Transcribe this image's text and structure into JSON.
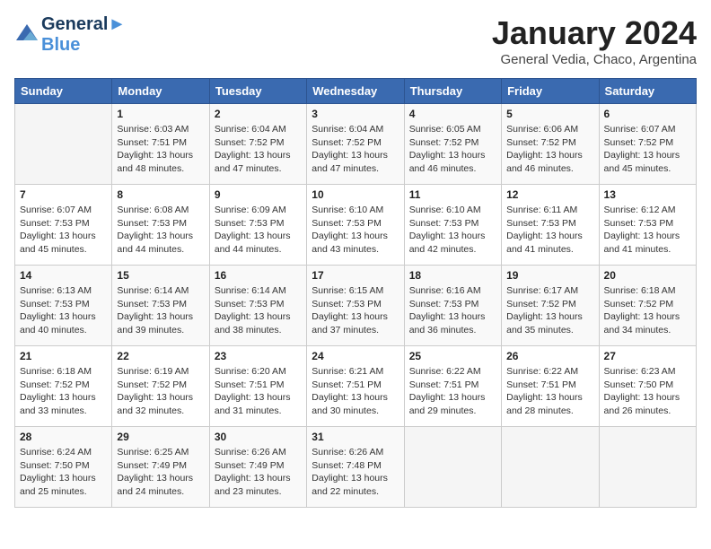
{
  "header": {
    "logo_line1": "General",
    "logo_line2": "Blue",
    "month": "January 2024",
    "location": "General Vedia, Chaco, Argentina"
  },
  "weekdays": [
    "Sunday",
    "Monday",
    "Tuesday",
    "Wednesday",
    "Thursday",
    "Friday",
    "Saturday"
  ],
  "weeks": [
    [
      {
        "day": "",
        "info": ""
      },
      {
        "day": "1",
        "info": "Sunrise: 6:03 AM\nSunset: 7:51 PM\nDaylight: 13 hours\nand 48 minutes."
      },
      {
        "day": "2",
        "info": "Sunrise: 6:04 AM\nSunset: 7:52 PM\nDaylight: 13 hours\nand 47 minutes."
      },
      {
        "day": "3",
        "info": "Sunrise: 6:04 AM\nSunset: 7:52 PM\nDaylight: 13 hours\nand 47 minutes."
      },
      {
        "day": "4",
        "info": "Sunrise: 6:05 AM\nSunset: 7:52 PM\nDaylight: 13 hours\nand 46 minutes."
      },
      {
        "day": "5",
        "info": "Sunrise: 6:06 AM\nSunset: 7:52 PM\nDaylight: 13 hours\nand 46 minutes."
      },
      {
        "day": "6",
        "info": "Sunrise: 6:07 AM\nSunset: 7:52 PM\nDaylight: 13 hours\nand 45 minutes."
      }
    ],
    [
      {
        "day": "7",
        "info": "Sunrise: 6:07 AM\nSunset: 7:53 PM\nDaylight: 13 hours\nand 45 minutes."
      },
      {
        "day": "8",
        "info": "Sunrise: 6:08 AM\nSunset: 7:53 PM\nDaylight: 13 hours\nand 44 minutes."
      },
      {
        "day": "9",
        "info": "Sunrise: 6:09 AM\nSunset: 7:53 PM\nDaylight: 13 hours\nand 44 minutes."
      },
      {
        "day": "10",
        "info": "Sunrise: 6:10 AM\nSunset: 7:53 PM\nDaylight: 13 hours\nand 43 minutes."
      },
      {
        "day": "11",
        "info": "Sunrise: 6:10 AM\nSunset: 7:53 PM\nDaylight: 13 hours\nand 42 minutes."
      },
      {
        "day": "12",
        "info": "Sunrise: 6:11 AM\nSunset: 7:53 PM\nDaylight: 13 hours\nand 41 minutes."
      },
      {
        "day": "13",
        "info": "Sunrise: 6:12 AM\nSunset: 7:53 PM\nDaylight: 13 hours\nand 41 minutes."
      }
    ],
    [
      {
        "day": "14",
        "info": "Sunrise: 6:13 AM\nSunset: 7:53 PM\nDaylight: 13 hours\nand 40 minutes."
      },
      {
        "day": "15",
        "info": "Sunrise: 6:14 AM\nSunset: 7:53 PM\nDaylight: 13 hours\nand 39 minutes."
      },
      {
        "day": "16",
        "info": "Sunrise: 6:14 AM\nSunset: 7:53 PM\nDaylight: 13 hours\nand 38 minutes."
      },
      {
        "day": "17",
        "info": "Sunrise: 6:15 AM\nSunset: 7:53 PM\nDaylight: 13 hours\nand 37 minutes."
      },
      {
        "day": "18",
        "info": "Sunrise: 6:16 AM\nSunset: 7:53 PM\nDaylight: 13 hours\nand 36 minutes."
      },
      {
        "day": "19",
        "info": "Sunrise: 6:17 AM\nSunset: 7:52 PM\nDaylight: 13 hours\nand 35 minutes."
      },
      {
        "day": "20",
        "info": "Sunrise: 6:18 AM\nSunset: 7:52 PM\nDaylight: 13 hours\nand 34 minutes."
      }
    ],
    [
      {
        "day": "21",
        "info": "Sunrise: 6:18 AM\nSunset: 7:52 PM\nDaylight: 13 hours\nand 33 minutes."
      },
      {
        "day": "22",
        "info": "Sunrise: 6:19 AM\nSunset: 7:52 PM\nDaylight: 13 hours\nand 32 minutes."
      },
      {
        "day": "23",
        "info": "Sunrise: 6:20 AM\nSunset: 7:51 PM\nDaylight: 13 hours\nand 31 minutes."
      },
      {
        "day": "24",
        "info": "Sunrise: 6:21 AM\nSunset: 7:51 PM\nDaylight: 13 hours\nand 30 minutes."
      },
      {
        "day": "25",
        "info": "Sunrise: 6:22 AM\nSunset: 7:51 PM\nDaylight: 13 hours\nand 29 minutes."
      },
      {
        "day": "26",
        "info": "Sunrise: 6:22 AM\nSunset: 7:51 PM\nDaylight: 13 hours\nand 28 minutes."
      },
      {
        "day": "27",
        "info": "Sunrise: 6:23 AM\nSunset: 7:50 PM\nDaylight: 13 hours\nand 26 minutes."
      }
    ],
    [
      {
        "day": "28",
        "info": "Sunrise: 6:24 AM\nSunset: 7:50 PM\nDaylight: 13 hours\nand 25 minutes."
      },
      {
        "day": "29",
        "info": "Sunrise: 6:25 AM\nSunset: 7:49 PM\nDaylight: 13 hours\nand 24 minutes."
      },
      {
        "day": "30",
        "info": "Sunrise: 6:26 AM\nSunset: 7:49 PM\nDaylight: 13 hours\nand 23 minutes."
      },
      {
        "day": "31",
        "info": "Sunrise: 6:26 AM\nSunset: 7:48 PM\nDaylight: 13 hours\nand 22 minutes."
      },
      {
        "day": "",
        "info": ""
      },
      {
        "day": "",
        "info": ""
      },
      {
        "day": "",
        "info": ""
      }
    ]
  ]
}
